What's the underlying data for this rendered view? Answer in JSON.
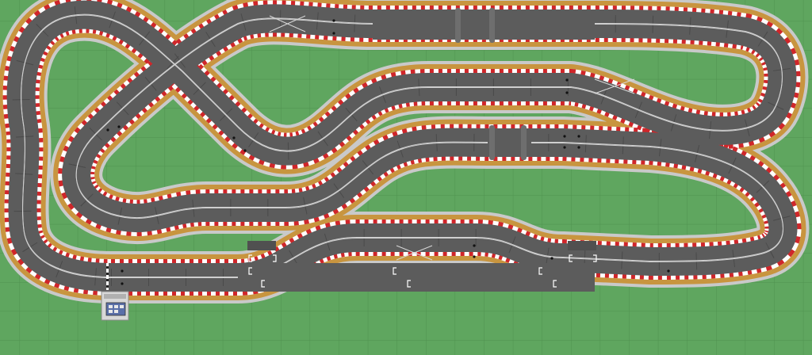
{
  "colors": {
    "grass": "#5fa65f",
    "grid_line": "#4f914f",
    "asphalt": "#5c5c5c",
    "asphalt_dark": "#505050",
    "curb": "#c9c9c9",
    "sand": "#c8953f",
    "kerb_white": "#ffffff",
    "kerb_red": "#d0262a",
    "slot": "#cfcfcf",
    "pier": "#6e6e6e",
    "start_line": "#ffffff"
  },
  "icons": {
    "lap_counter": "lap-counter-icon",
    "bridge_pier": "bridge-pier-icon",
    "lane_change": "lane-change-icon",
    "pit_marker": "pit-marker-icon"
  }
}
